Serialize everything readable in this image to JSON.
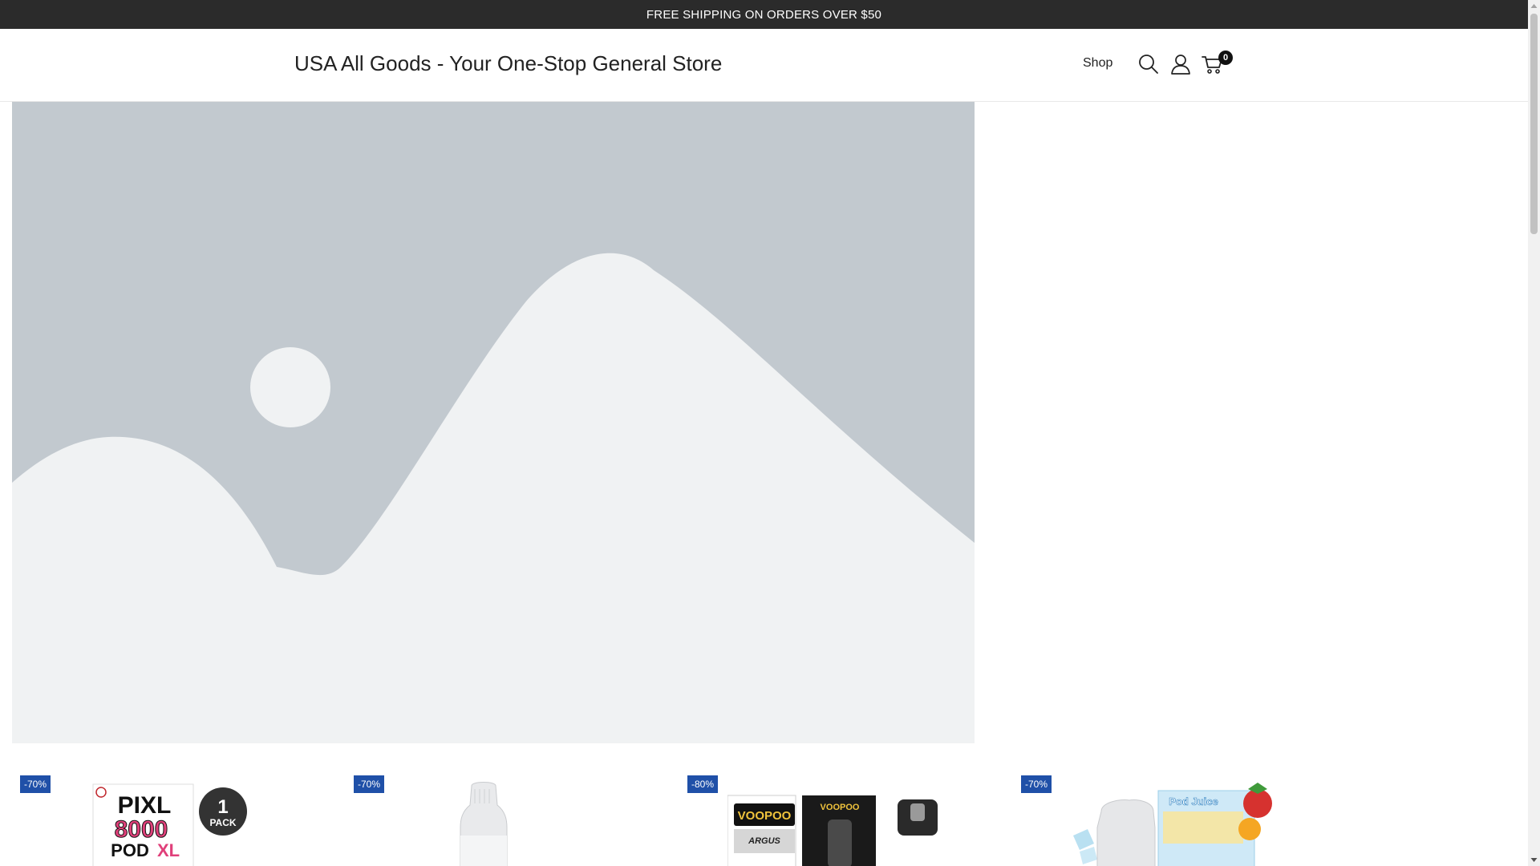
{
  "announcement": {
    "text": "FREE SHIPPING ON ORDERS OVER $50"
  },
  "header": {
    "site_title": "USA All Goods - Your One-Stop General Store",
    "nav": [
      {
        "label": "Shop"
      }
    ],
    "icons": [
      "search-icon",
      "account-icon",
      "cart-icon"
    ],
    "cart_count": "0"
  },
  "hero": {
    "type": "image-placeholder"
  },
  "products": [
    {
      "discount": "-70%",
      "image_text": {
        "brand": "PIXL",
        "line2": "8000",
        "line3_a": "POD",
        "line3_b": "XL",
        "pack_num": "1",
        "pack_word": "PACK"
      }
    },
    {
      "discount": "-70%"
    },
    {
      "discount": "-80%",
      "image_text": {
        "brand_left": "VOOPOO",
        "model": "ARGUS",
        "brand_right": "VOOPOO"
      }
    },
    {
      "discount": "-70%",
      "image_text": {
        "brand": "Pod Juice"
      }
    }
  ],
  "colors": {
    "announcement_bg": "#2b2b2b",
    "badge_bg": "#1f50a8",
    "hero_bg": "#c2c9cf",
    "hero_shape": "#f0f2f3"
  }
}
